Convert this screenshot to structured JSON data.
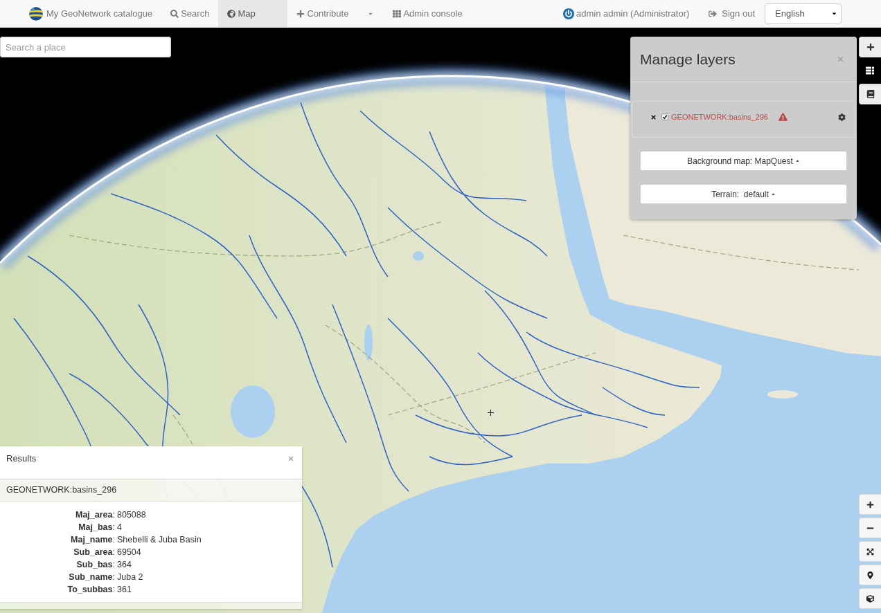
{
  "navbar": {
    "brand": "My GeoNetwork catalogue",
    "items": [
      {
        "kind": "link",
        "label": "Search",
        "selected": false
      },
      {
        "kind": "link",
        "label": "Map",
        "selected": true
      },
      {
        "kind": "link",
        "label": "Contribute",
        "selected": false
      },
      {
        "kind": "caret",
        "selected": false
      },
      {
        "kind": "link",
        "label": "Admin console",
        "selected": false
      }
    ],
    "user": "admin admin (Administrator)",
    "sign_out": "Sign out",
    "language": "English"
  },
  "search_place": {
    "placeholder": "Search a place"
  },
  "manage_layers": {
    "title": "Manage layers",
    "layers": [
      {
        "name": "GEONETWORK:basins_296",
        "visible": true,
        "error": true
      }
    ],
    "background_button": "Background map: MapQuest",
    "terrain_button": "Terrain:  default"
  },
  "map_tools": [
    {
      "selected": false
    },
    {
      "selected": true
    },
    {
      "selected": false
    }
  ],
  "results": {
    "title": "Results",
    "layer": "GEONETWORK:basins_296",
    "attributes": [
      {
        "label": "**Maj_area**:",
        "value": "805088"
      },
      {
        "label": "**Maj_bas**:",
        "value": "4"
      },
      {
        "label": "**Maj_name**:",
        "value": "Shebelli & Juba Basin"
      },
      {
        "label": "**Sub_area**:",
        "value": "69504"
      },
      {
        "label": "**Sub_bas**:",
        "value": "364"
      },
      {
        "label": "**Sub_name**:",
        "value": "Juba 2"
      },
      {
        "label": "**To_subbas**:",
        "value": "361"
      }
    ]
  }
}
